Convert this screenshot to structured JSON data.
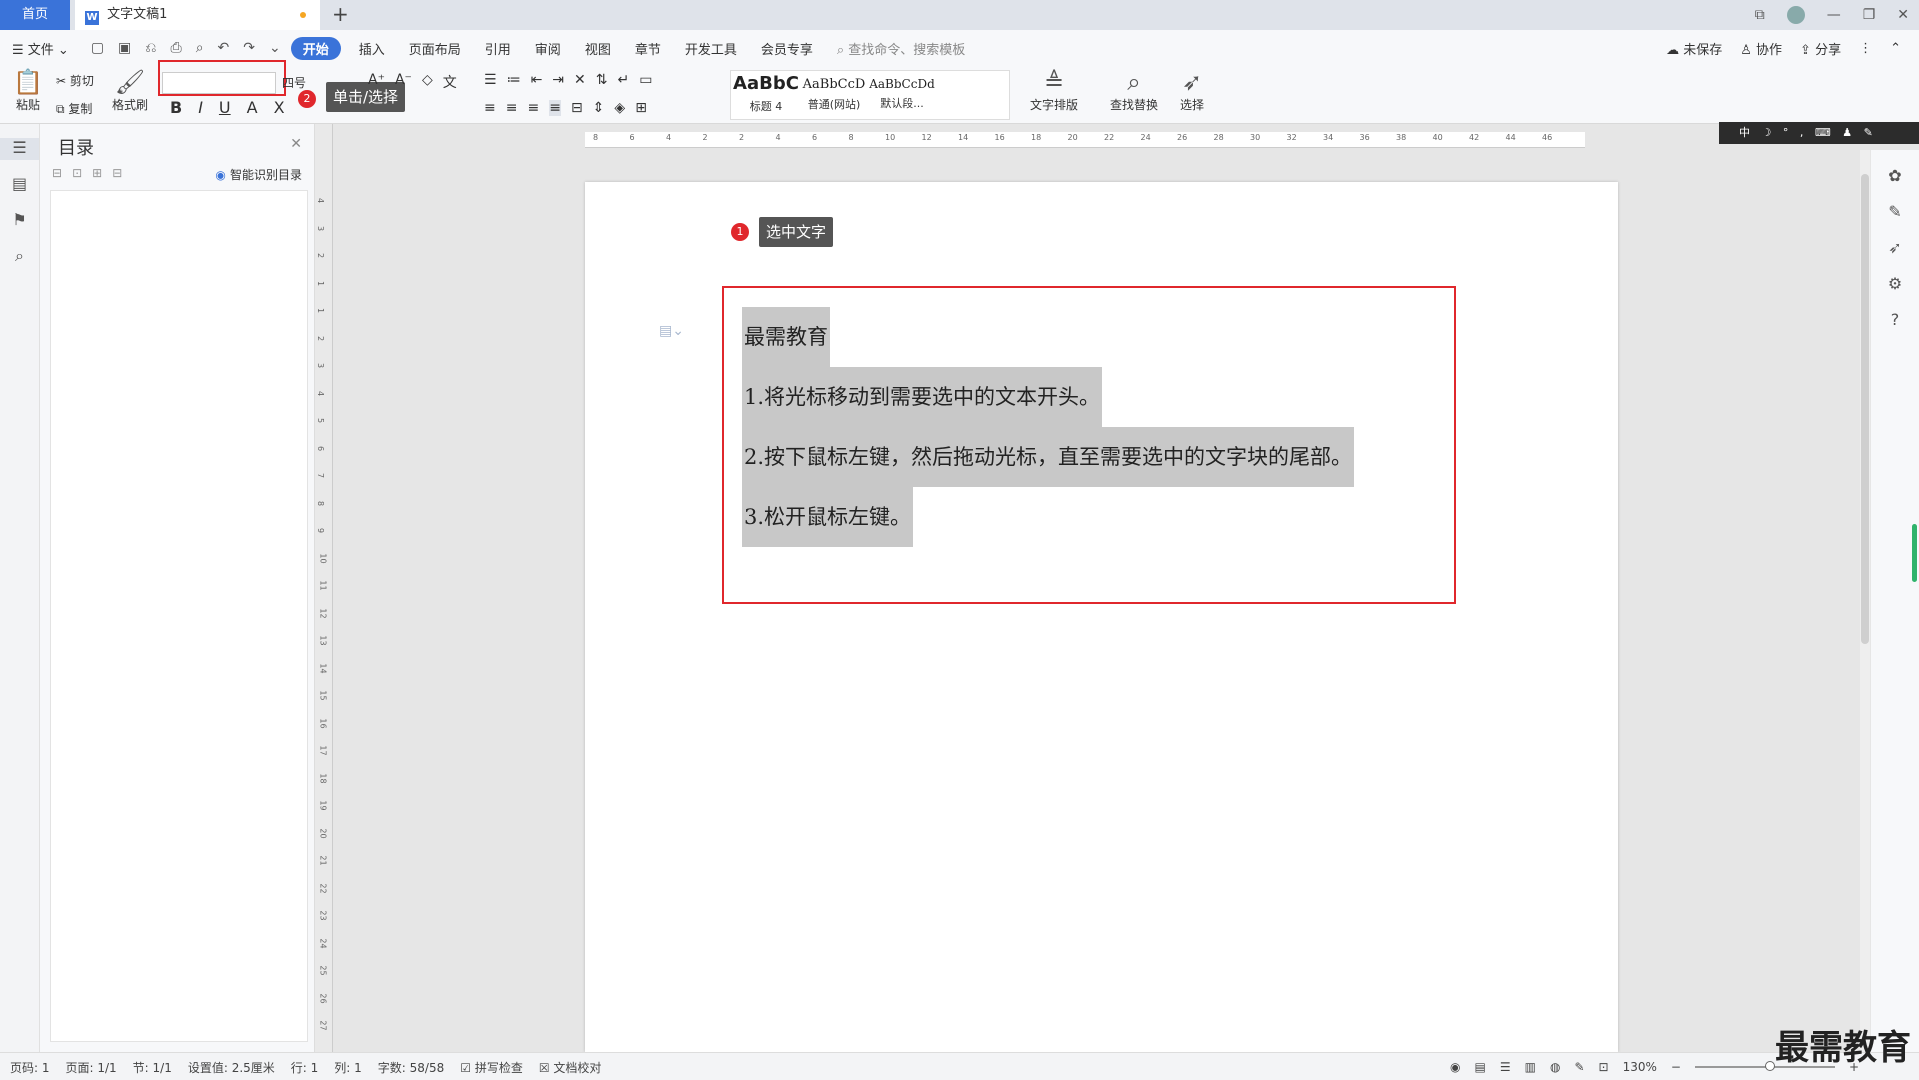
{
  "tabs": {
    "home": "首页",
    "doc": "文字文稿1",
    "plus": "+"
  },
  "window": {
    "ctrl1": "⧉",
    "ctrl2": "—",
    "ctrl3": "❐",
    "ctrl4": "✕"
  },
  "menu": {
    "file": "☰ 文件 ⌄",
    "items": [
      "开始",
      "插入",
      "页面布局",
      "引用",
      "审阅",
      "视图",
      "章节",
      "开发工具",
      "会员专享"
    ],
    "search": "查找命令、搜索模板",
    "unsaved": "未保存",
    "collab": "协作",
    "share": "分享"
  },
  "ribbon": {
    "paste": "粘贴",
    "cut": "剪切",
    "copy": "复制",
    "format_painter": "格式刷",
    "font_size": "四号",
    "callout2": "单击/选择",
    "styles": [
      {
        "sample": "AaBbC",
        "name": "标题 4"
      },
      {
        "sample": "AaBbCcD",
        "name": "普通(网站)"
      },
      {
        "sample": "AaBbCcDd",
        "name": "默认段..."
      }
    ],
    "text_layout": "文字排版",
    "find_replace": "查找替换",
    "select": "选择"
  },
  "ime": "中 ☽ ° , ⌨ ♟ ✎",
  "toc": {
    "title": "目录",
    "smart": "智能识别目录"
  },
  "document": {
    "callout1": "选中文字",
    "lines": [
      "最需教育",
      "1.将光标移动到需要选中的文本开头。",
      "2.按下鼠标左键，然后拖动光标，直至需要选中的文字块的尾部。",
      "3.松开鼠标左键。"
    ]
  },
  "hruler_ticks": [
    "8",
    "6",
    "4",
    "2",
    "2",
    "4",
    "6",
    "8",
    "10",
    "12",
    "14",
    "16",
    "18",
    "20",
    "22",
    "24",
    "26",
    "28",
    "30",
    "32",
    "34",
    "36",
    "38",
    "40",
    "42",
    "44",
    "46"
  ],
  "vruler_ticks": [
    "4",
    "3",
    "2",
    "1",
    "1",
    "2",
    "3",
    "4",
    "5",
    "6",
    "7",
    "8",
    "9",
    "10",
    "11",
    "12",
    "13",
    "14",
    "15",
    "16",
    "17",
    "18",
    "19",
    "20",
    "21",
    "22",
    "23",
    "24",
    "25",
    "26",
    "27"
  ],
  "status": {
    "page": "页码: 1",
    "pages": "页面: 1/1",
    "section": "节: 1/1",
    "setting": "设置值: 2.5厘米",
    "row": "行: 1",
    "col": "列: 1",
    "words": "字数: 58/58",
    "spell": "拼写检查",
    "proof": "文档校对",
    "zoom": "130%"
  },
  "watermark": "最需教育",
  "colors": {
    "accent": "#3a73d9",
    "highlight": "#e0272c",
    "selection": "#c8c8c8"
  }
}
